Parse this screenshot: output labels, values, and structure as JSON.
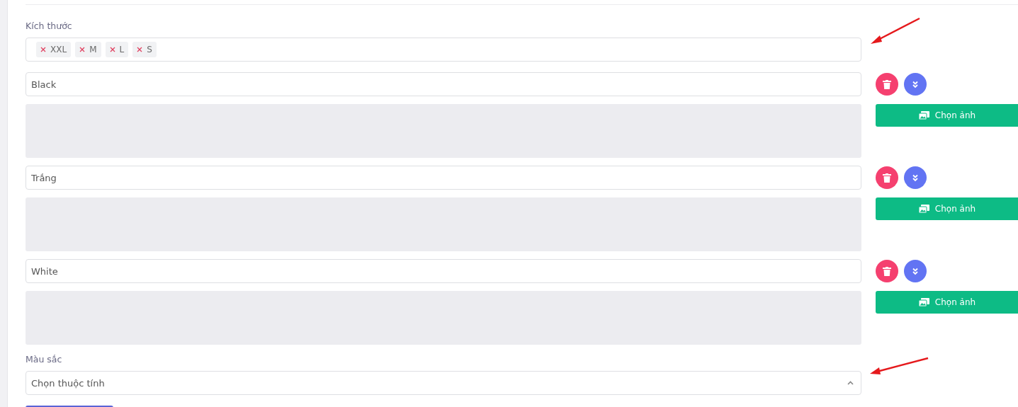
{
  "size_field": {
    "label": "Kích thước",
    "tags": [
      {
        "label": "XXL"
      },
      {
        "label": "M"
      },
      {
        "label": "L"
      },
      {
        "label": "S"
      }
    ]
  },
  "variants": [
    {
      "value": "Black",
      "image_button": "Chọn ảnh"
    },
    {
      "value": "Trắng",
      "image_button": "Chọn ảnh"
    },
    {
      "value": "White",
      "image_button": "Chọn ảnh"
    }
  ],
  "color_field": {
    "label": "Màu sắc",
    "placeholder": "Chọn thuộc tính"
  }
}
